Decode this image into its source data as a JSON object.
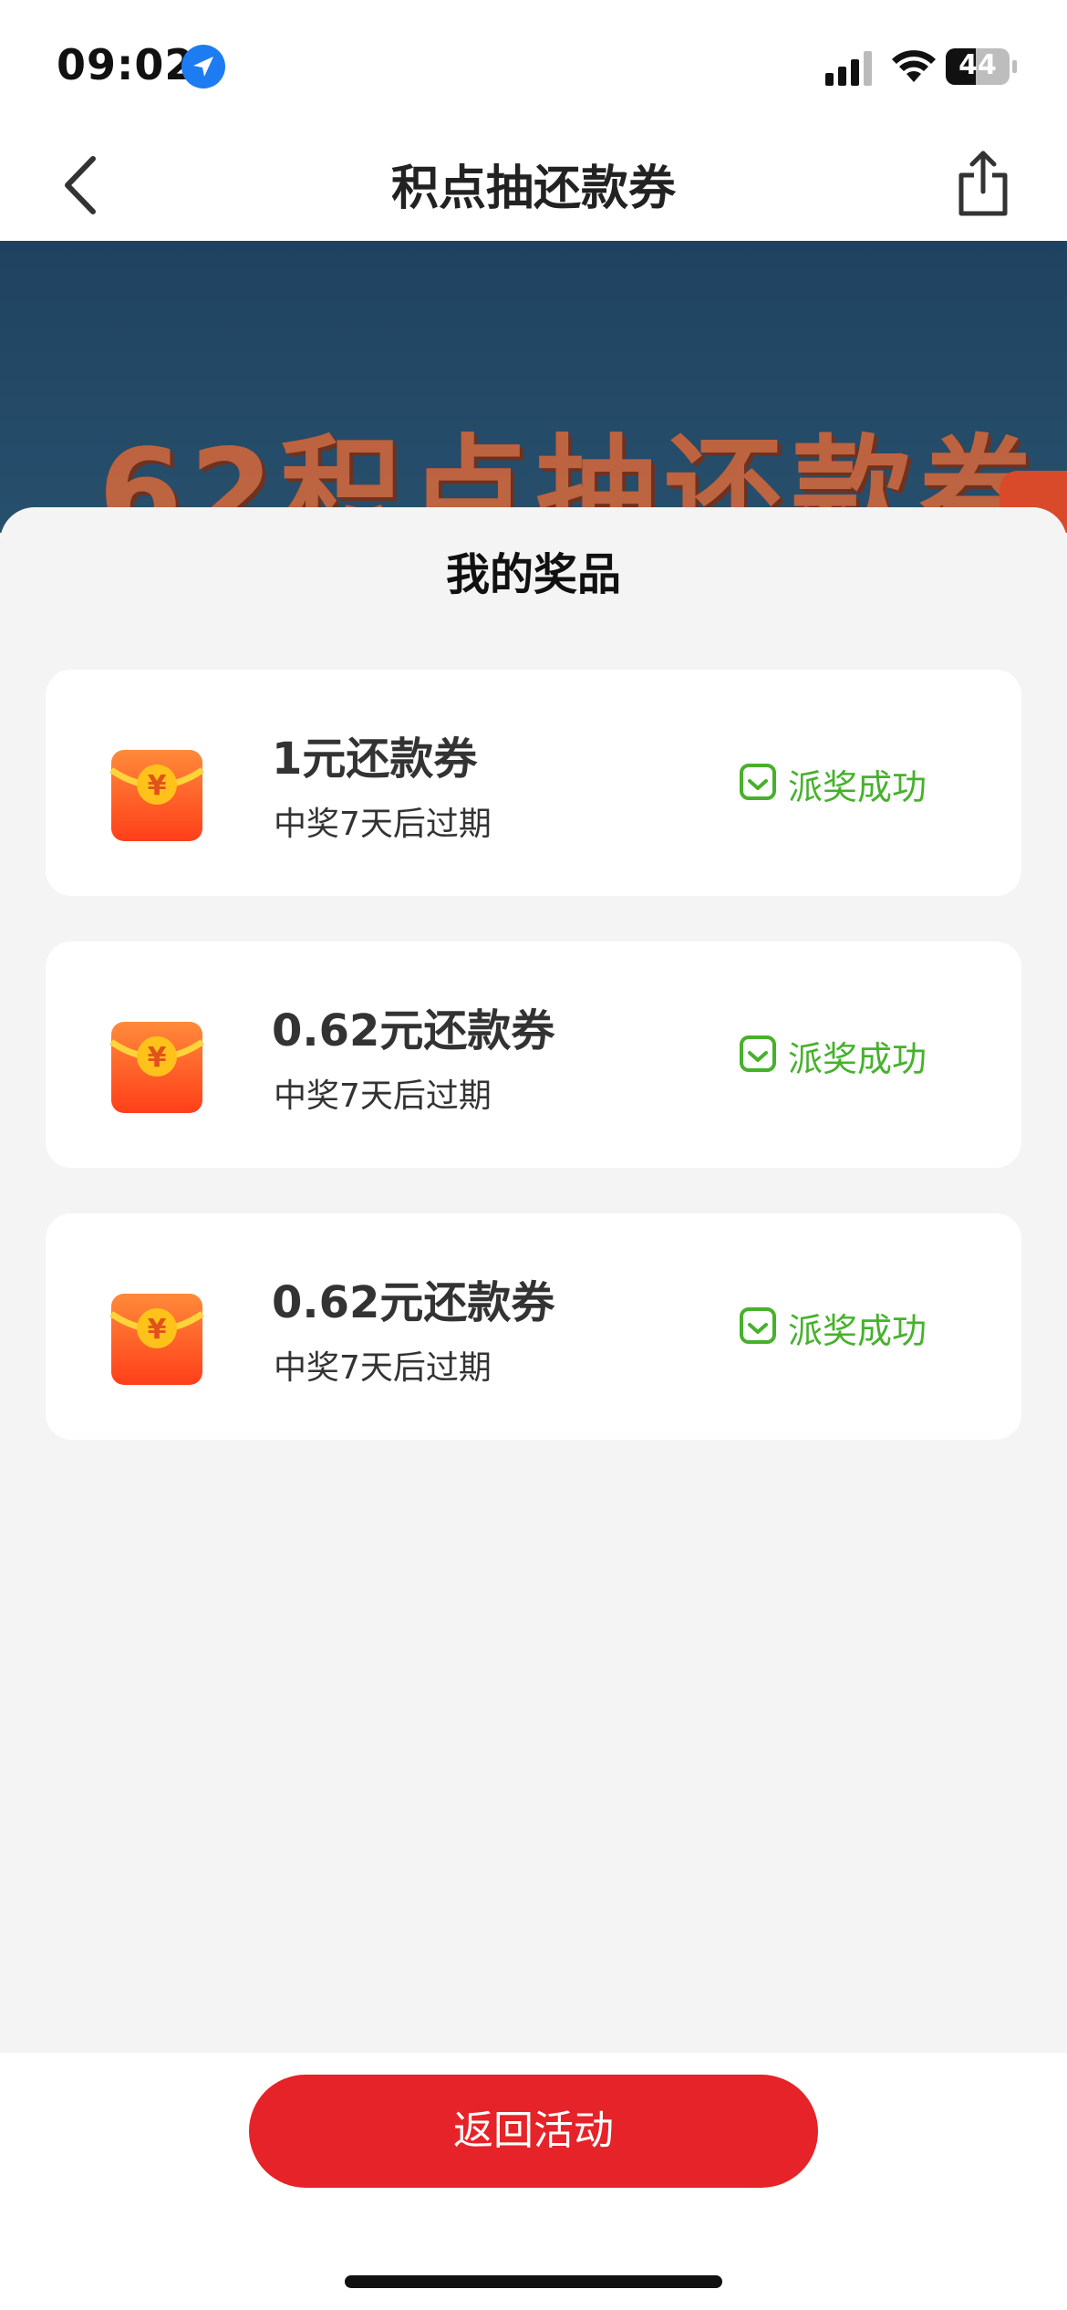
{
  "status_bar": {
    "time": "09:02",
    "battery": "44"
  },
  "nav": {
    "title": "积点抽还款券"
  },
  "banner": {
    "title": "62积点抽还款券"
  },
  "sheet": {
    "title": "我的奖品",
    "prizes": [
      {
        "name": "1元还款券",
        "expiry": "中奖7天后过期",
        "status": "派奖成功"
      },
      {
        "name": "0.62元还款券",
        "expiry": "中奖7天后过期",
        "status": "派奖成功"
      },
      {
        "name": "0.62元还款券",
        "expiry": "中奖7天后过期",
        "status": "派奖成功"
      }
    ]
  },
  "footer": {
    "return_label": "返回活动"
  },
  "colors": {
    "accent_red": "#e62328",
    "success_green": "#47b12c",
    "banner_blue": "#1f4260"
  },
  "icons": [
    "location-arrow-icon",
    "signal-icon",
    "wifi-icon",
    "battery-icon",
    "back-icon",
    "share-icon",
    "red-envelope-icon",
    "check-shield-icon"
  ]
}
